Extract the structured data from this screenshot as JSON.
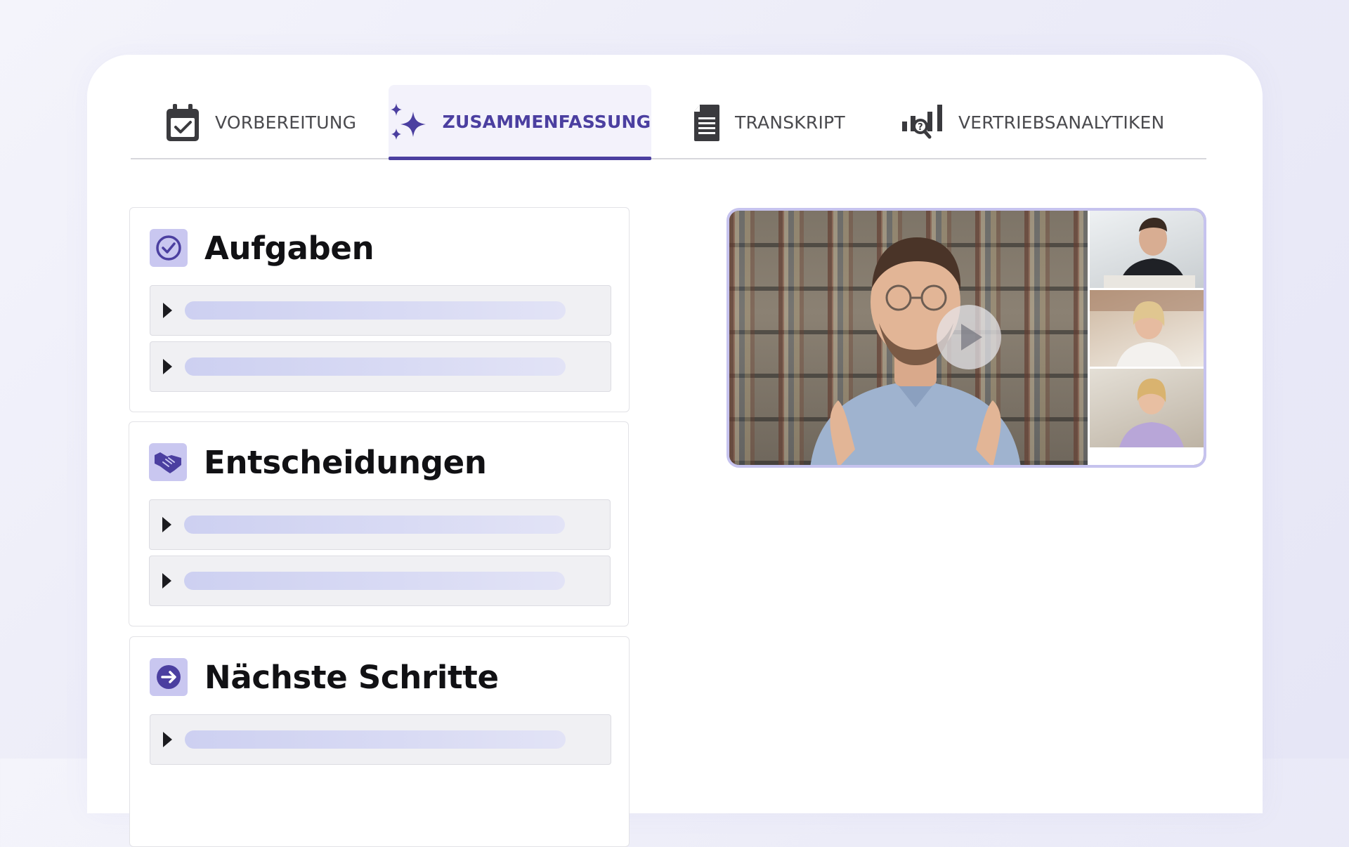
{
  "tabs": [
    {
      "id": "vorbereitung",
      "label": "VORBEREITUNG",
      "icon": "calendar-check-icon",
      "active": false
    },
    {
      "id": "zusammenfassung",
      "label": "ZUSAMMENFASSUNG",
      "icon": "sparkles-icon",
      "active": true
    },
    {
      "id": "transkript",
      "label": "TRANSKRIPT",
      "icon": "document-icon",
      "active": false
    },
    {
      "id": "vertriebsanalytiken",
      "label": "VERTRIEBSANALYTIKEN",
      "icon": "analytics-search-icon",
      "active": false
    }
  ],
  "sections": {
    "aufgaben": {
      "title": "Aufgaben",
      "icon": "check-circle-icon"
    },
    "entscheidungen": {
      "title": "Entscheidungen",
      "icon": "handshake-icon"
    },
    "naechste_schritte": {
      "title": "Nächste Schritte",
      "icon": "arrow-right-circle-icon"
    }
  },
  "colors": {
    "accent": "#4b3fa0",
    "icon_bg": "#c9c7f0",
    "placeholder_bar": "#d3d5f2"
  }
}
